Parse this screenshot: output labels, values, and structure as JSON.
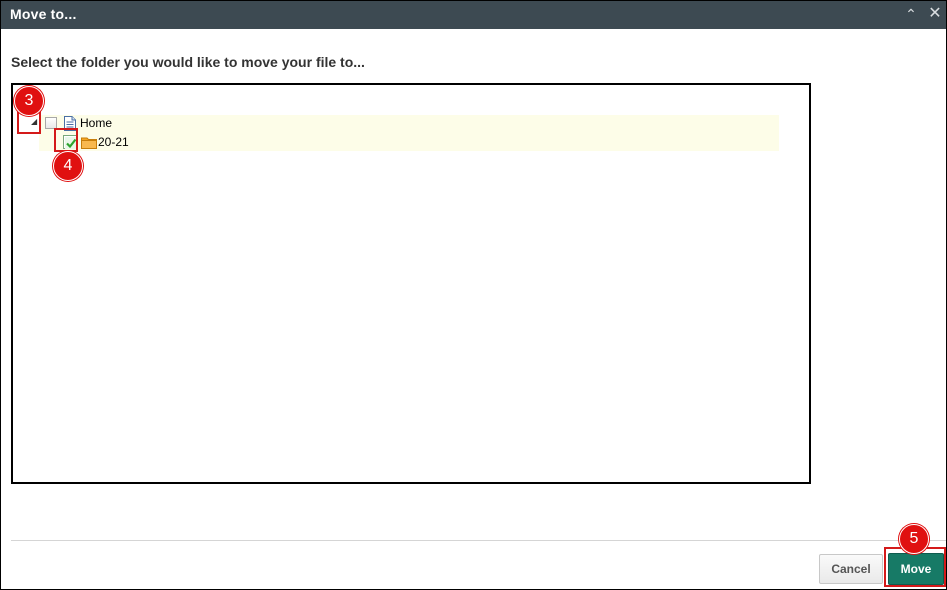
{
  "dialog": {
    "title": "Move to...",
    "collapse_icon": "chevron-up-icon",
    "close_icon": "close-icon"
  },
  "instruction": "Select the folder you would like to move your file to...",
  "tree": {
    "root": {
      "label": "Home",
      "icon": "document-icon",
      "expanded": true,
      "checked": false
    },
    "children": [
      {
        "label": "20-21",
        "icon": "folder-icon",
        "checked": true
      }
    ]
  },
  "annotations": {
    "step3": "3",
    "step4": "4",
    "step5": "5",
    "highlight_color": "#d41a1a",
    "badge_color": "#e01010"
  },
  "buttons": {
    "cancel": "Cancel",
    "move": "Move",
    "move_color": "#177a66"
  },
  "colors": {
    "titlebar": "#3d4a52",
    "row_highlight": "#fdfde8"
  }
}
